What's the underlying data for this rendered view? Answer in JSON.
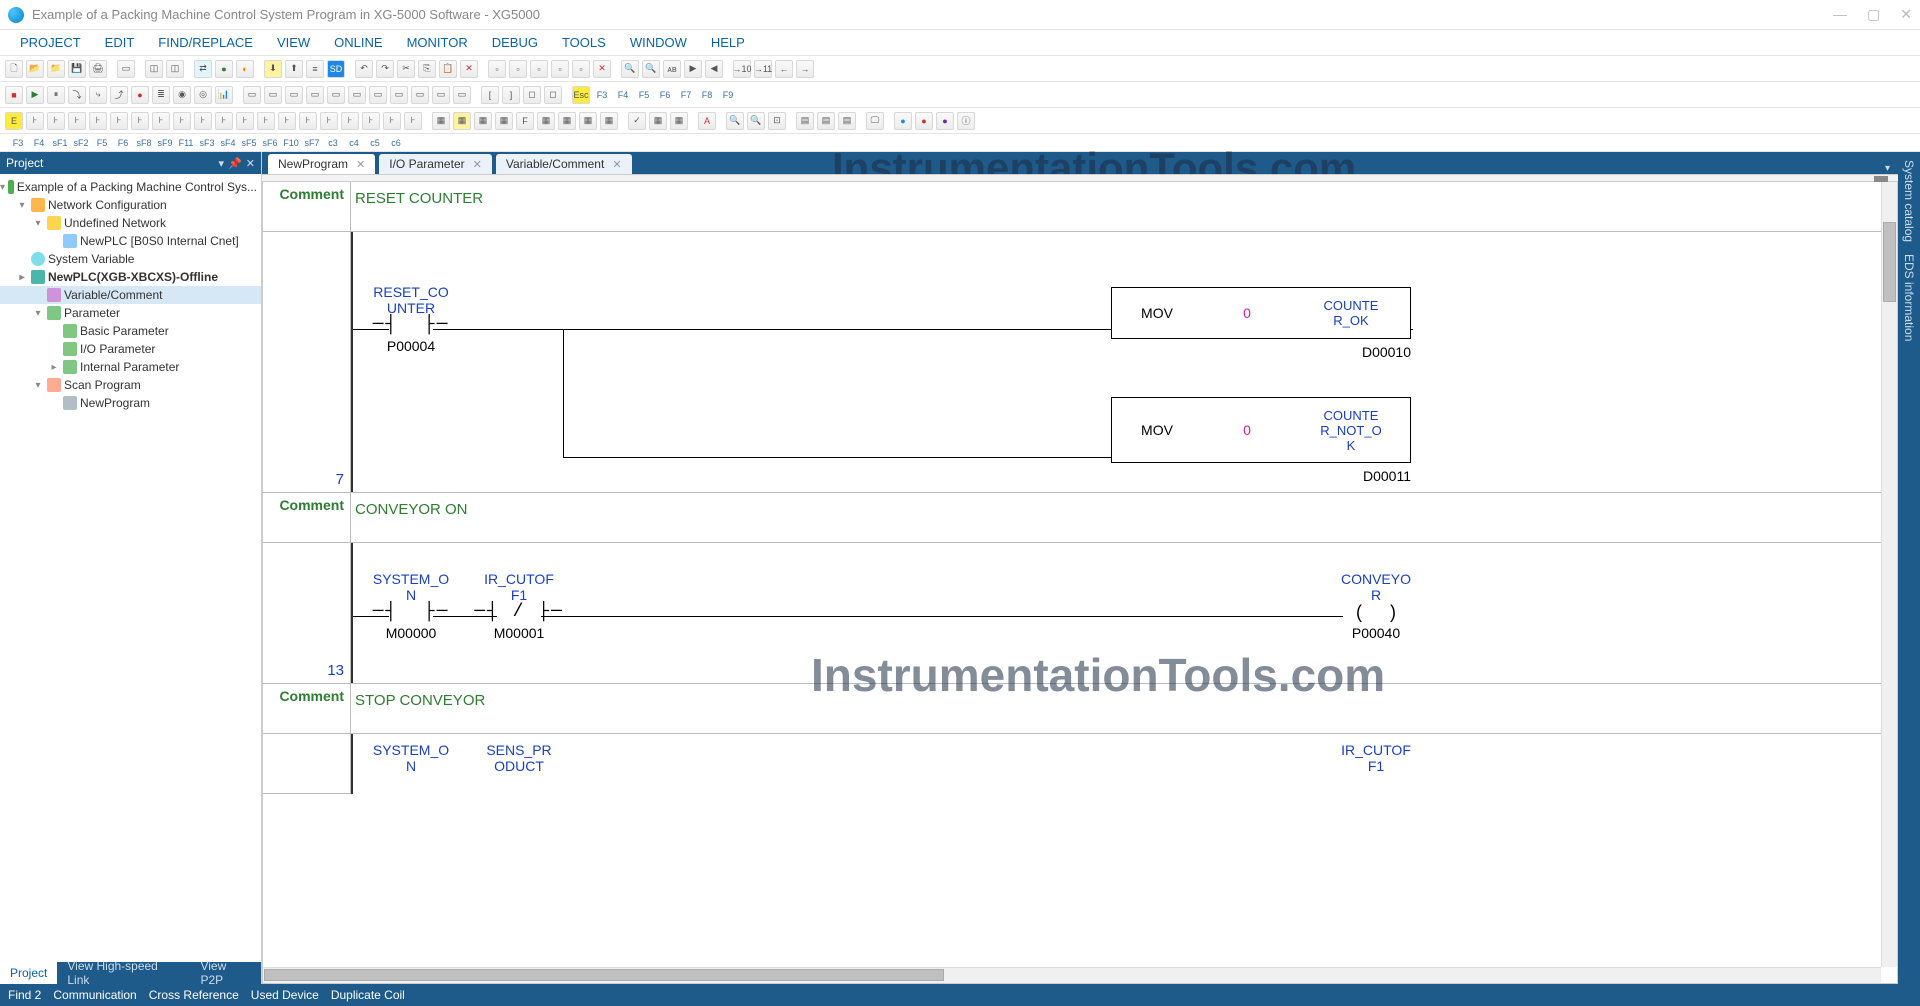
{
  "window": {
    "title": "Example of a Packing Machine Control System Program in XG-5000 Software - XG5000"
  },
  "menu": [
    "PROJECT",
    "EDIT",
    "FIND/REPLACE",
    "VIEW",
    "ONLINE",
    "MONITOR",
    "DEBUG",
    "TOOLS",
    "WINDOW",
    "HELP"
  ],
  "project_panel": {
    "title": "Project",
    "root": "Example of a Packing Machine Control Sys...",
    "net_config": "Network Configuration",
    "undef_net": "Undefined Network",
    "newplc_cnet": "NewPLC [B0S0 Internal Cnet]",
    "sys_var": "System Variable",
    "plc_node": "NewPLC(XGB-XBCXS)-Offline",
    "var_comment": "Variable/Comment",
    "parameter": "Parameter",
    "basic_param": "Basic Parameter",
    "io_param": "I/O Parameter",
    "internal_param": "Internal Parameter",
    "scan_prog": "Scan Program",
    "new_program": "NewProgram"
  },
  "bottom_tabs": {
    "project": "Project",
    "hsl": "View High-speed Link",
    "p2p": "View P2P"
  },
  "doc_tabs": {
    "t1": "NewProgram",
    "t2": "I/O Parameter",
    "t3": "Variable/Comment"
  },
  "side_tabs": {
    "catalog": "System catalog",
    "eds": "EDS information"
  },
  "watermark": "InstrumentationTools.com",
  "status": [
    "Find 2",
    "Communication",
    "Cross Reference",
    "Used Device",
    "Duplicate Coil"
  ],
  "ladder": {
    "comment_label": "Comment",
    "rung1_comment": "RESET COUNTER",
    "rung1_no": "7",
    "reset_counter_name": "RESET_COUNTER",
    "reset_counter_addr": "P00004",
    "mov": "MOV",
    "zero": "0",
    "counter_ok": "COUNTER_OK",
    "counter_ok_addr": "D00010",
    "counter_not_ok": "COUNTER_NOT_OK",
    "counter_not_ok_addr": "D00011",
    "rung2_comment": "CONVEYOR ON",
    "rung2_no": "13",
    "system_on": "SYSTEM_ON",
    "system_on_addr": "M00000",
    "ir_cutoff1": "IR_CUTOFF1",
    "ir_cutoff1_addr": "M00001",
    "conveyor": "CONVEYOR",
    "conveyor_addr": "P00040",
    "rung3_comment": "STOP CONVEYOR",
    "sens_product": "SENS_PRODUCT",
    "ir_cutoff1_out": "IR_CUTOFF1"
  },
  "tb_row4_labels": [
    "F3",
    "F4",
    "sF1",
    "sF2",
    "F5",
    "F6",
    "sF8",
    "sF9",
    "F11",
    "sF3",
    "sF4",
    "sF5",
    "sF6",
    "F10",
    "sF7",
    "c3",
    "c4",
    "c5",
    "c6"
  ]
}
